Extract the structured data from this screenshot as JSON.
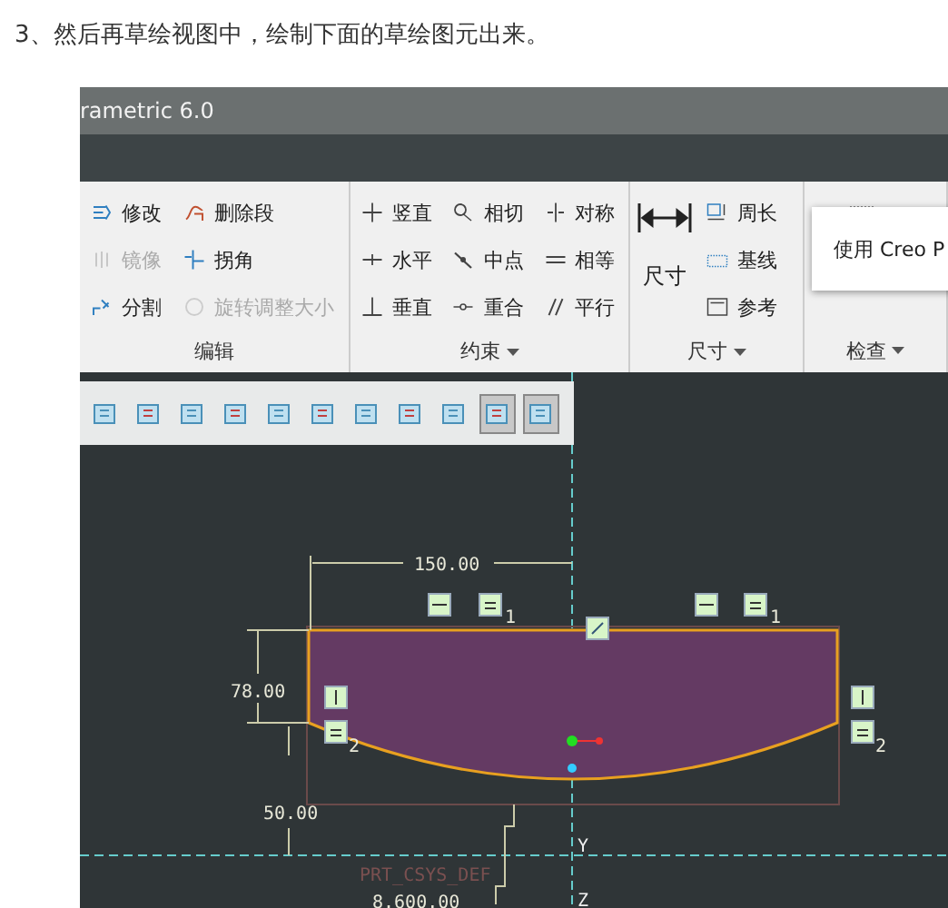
{
  "heading": "3、然后再草绘视图中，绘制下面的草绘图元出来。",
  "window": {
    "title": "rametric 6.0"
  },
  "ribbon": {
    "groups": [
      {
        "label": "编辑",
        "has_menu": false,
        "items": [
          {
            "label": "修改",
            "disabled": false
          },
          {
            "label": "镜像",
            "disabled": true
          },
          {
            "label": "分割",
            "disabled": false
          },
          {
            "label": "删除段",
            "disabled": false
          },
          {
            "label": "拐角",
            "disabled": false
          },
          {
            "label": "旋转调整大小",
            "disabled": true
          }
        ]
      },
      {
        "label": "约束",
        "has_menu": true,
        "items": [
          {
            "label": "竖直",
            "disabled": false
          },
          {
            "label": "水平",
            "disabled": false
          },
          {
            "label": "垂直",
            "disabled": false
          },
          {
            "label": "相切",
            "disabled": false
          },
          {
            "label": "中点",
            "disabled": false
          },
          {
            "label": "重合",
            "disabled": false
          },
          {
            "label": "对称",
            "disabled": false
          },
          {
            "label": "相等",
            "disabled": false
          },
          {
            "label": "平行",
            "disabled": false
          }
        ]
      },
      {
        "label": "尺寸",
        "has_menu": true,
        "large_button": "尺寸",
        "items": [
          {
            "label": "周长",
            "disabled": false
          },
          {
            "label": "基线",
            "disabled": false
          },
          {
            "label": "参考",
            "disabled": false
          }
        ]
      },
      {
        "label": "检查",
        "has_menu": true
      }
    ]
  },
  "popup": {
    "text": "使用 Creo P"
  },
  "view_toolbar": {
    "buttons": [
      {
        "selected": false
      },
      {
        "selected": false
      },
      {
        "selected": false
      },
      {
        "selected": false
      },
      {
        "selected": false
      },
      {
        "selected": false
      },
      {
        "selected": false
      },
      {
        "selected": false
      },
      {
        "selected": false
      },
      {
        "selected": true
      },
      {
        "selected": true
      }
    ]
  },
  "sketch": {
    "width_dimension": "150.00",
    "height_dimension": "78.00",
    "offset_dimension": "50.00",
    "radius_dimension": "8.600.00",
    "csys_label": "PRT_CSYS_DEF",
    "axis_labels": [
      "Y",
      "Z"
    ],
    "equal_subscripts": [
      "1",
      "1",
      "2",
      "2"
    ]
  }
}
